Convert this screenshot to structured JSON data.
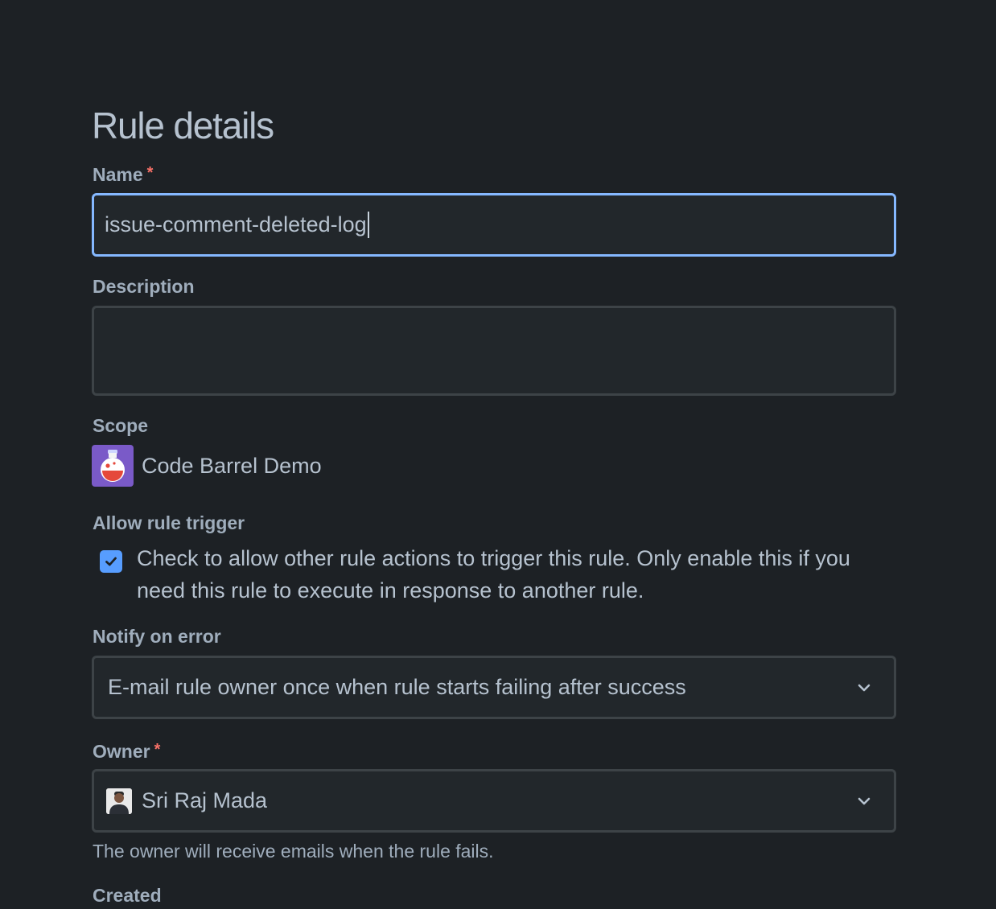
{
  "page": {
    "heading": "Rule details"
  },
  "name_field": {
    "label": "Name",
    "required_mark": "*",
    "value": "issue-comment-deleted-log"
  },
  "description_field": {
    "label": "Description",
    "value": ""
  },
  "scope": {
    "label": "Scope",
    "project_name": "Code Barrel Demo",
    "project_icon": "code-barrel-project-icon"
  },
  "allow_rule_trigger": {
    "label": "Allow rule trigger",
    "checked": true,
    "text": "Check to allow other rule actions to trigger this rule. Only enable this if you need this rule to execute in response to another rule."
  },
  "notify_on_error": {
    "label": "Notify on error",
    "selected": "E-mail rule owner once when rule starts failing after success"
  },
  "owner": {
    "label": "Owner",
    "required_mark": "*",
    "selected": "Sri Raj Mada",
    "helper": "The owner will receive emails when the rule fails."
  },
  "created": {
    "label": "Created"
  },
  "colors": {
    "background": "#1d2125",
    "input_bg": "#22272b",
    "focus_border": "#85b8ff",
    "checkbox": "#579dff",
    "required": "#f87168"
  }
}
